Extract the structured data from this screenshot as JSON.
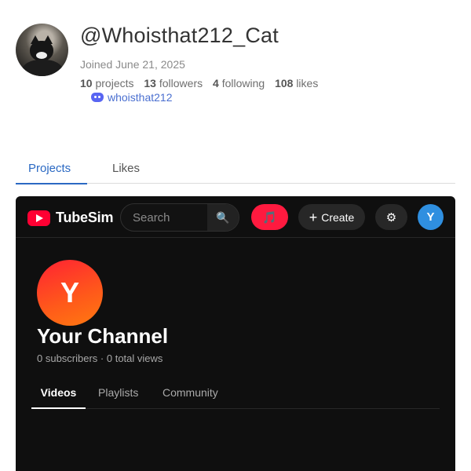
{
  "profile": {
    "username": "@Whoisthat212_Cat",
    "joined": "Joined June 21, 2025",
    "stats": [
      {
        "count": "10",
        "label": "projects"
      },
      {
        "count": "13",
        "label": "followers"
      },
      {
        "count": "4",
        "label": "following"
      },
      {
        "count": "108",
        "label": "likes"
      }
    ],
    "discord": {
      "handle": "whoisthat212",
      "icon": "discord-icon"
    }
  },
  "profile_tabs": [
    {
      "label": "Projects",
      "active": true
    },
    {
      "label": "Likes",
      "active": false
    }
  ],
  "embed": {
    "logo_text": "TubeSim",
    "search": {
      "placeholder": "Search",
      "value": "",
      "icon": "magnifier-icon"
    },
    "music_icon": "🎵",
    "create_label": "Create",
    "create_plus": "+",
    "gear_icon": "⚙",
    "search_icon": "🔍",
    "user_initial": "Y",
    "channel": {
      "initial": "Y",
      "name": "Your Channel",
      "meta": "0 subscribers · 0 total views"
    },
    "tabs": [
      {
        "label": "Videos",
        "active": true
      },
      {
        "label": "Playlists",
        "active": false
      },
      {
        "label": "Community",
        "active": false
      }
    ]
  },
  "colors": {
    "accent_link": "#2b69c3",
    "tube_red": "#ff0033",
    "music_red": "#ff1a3f",
    "user_blue": "#2f8fe0",
    "dark_bg": "#0f0f0f"
  }
}
